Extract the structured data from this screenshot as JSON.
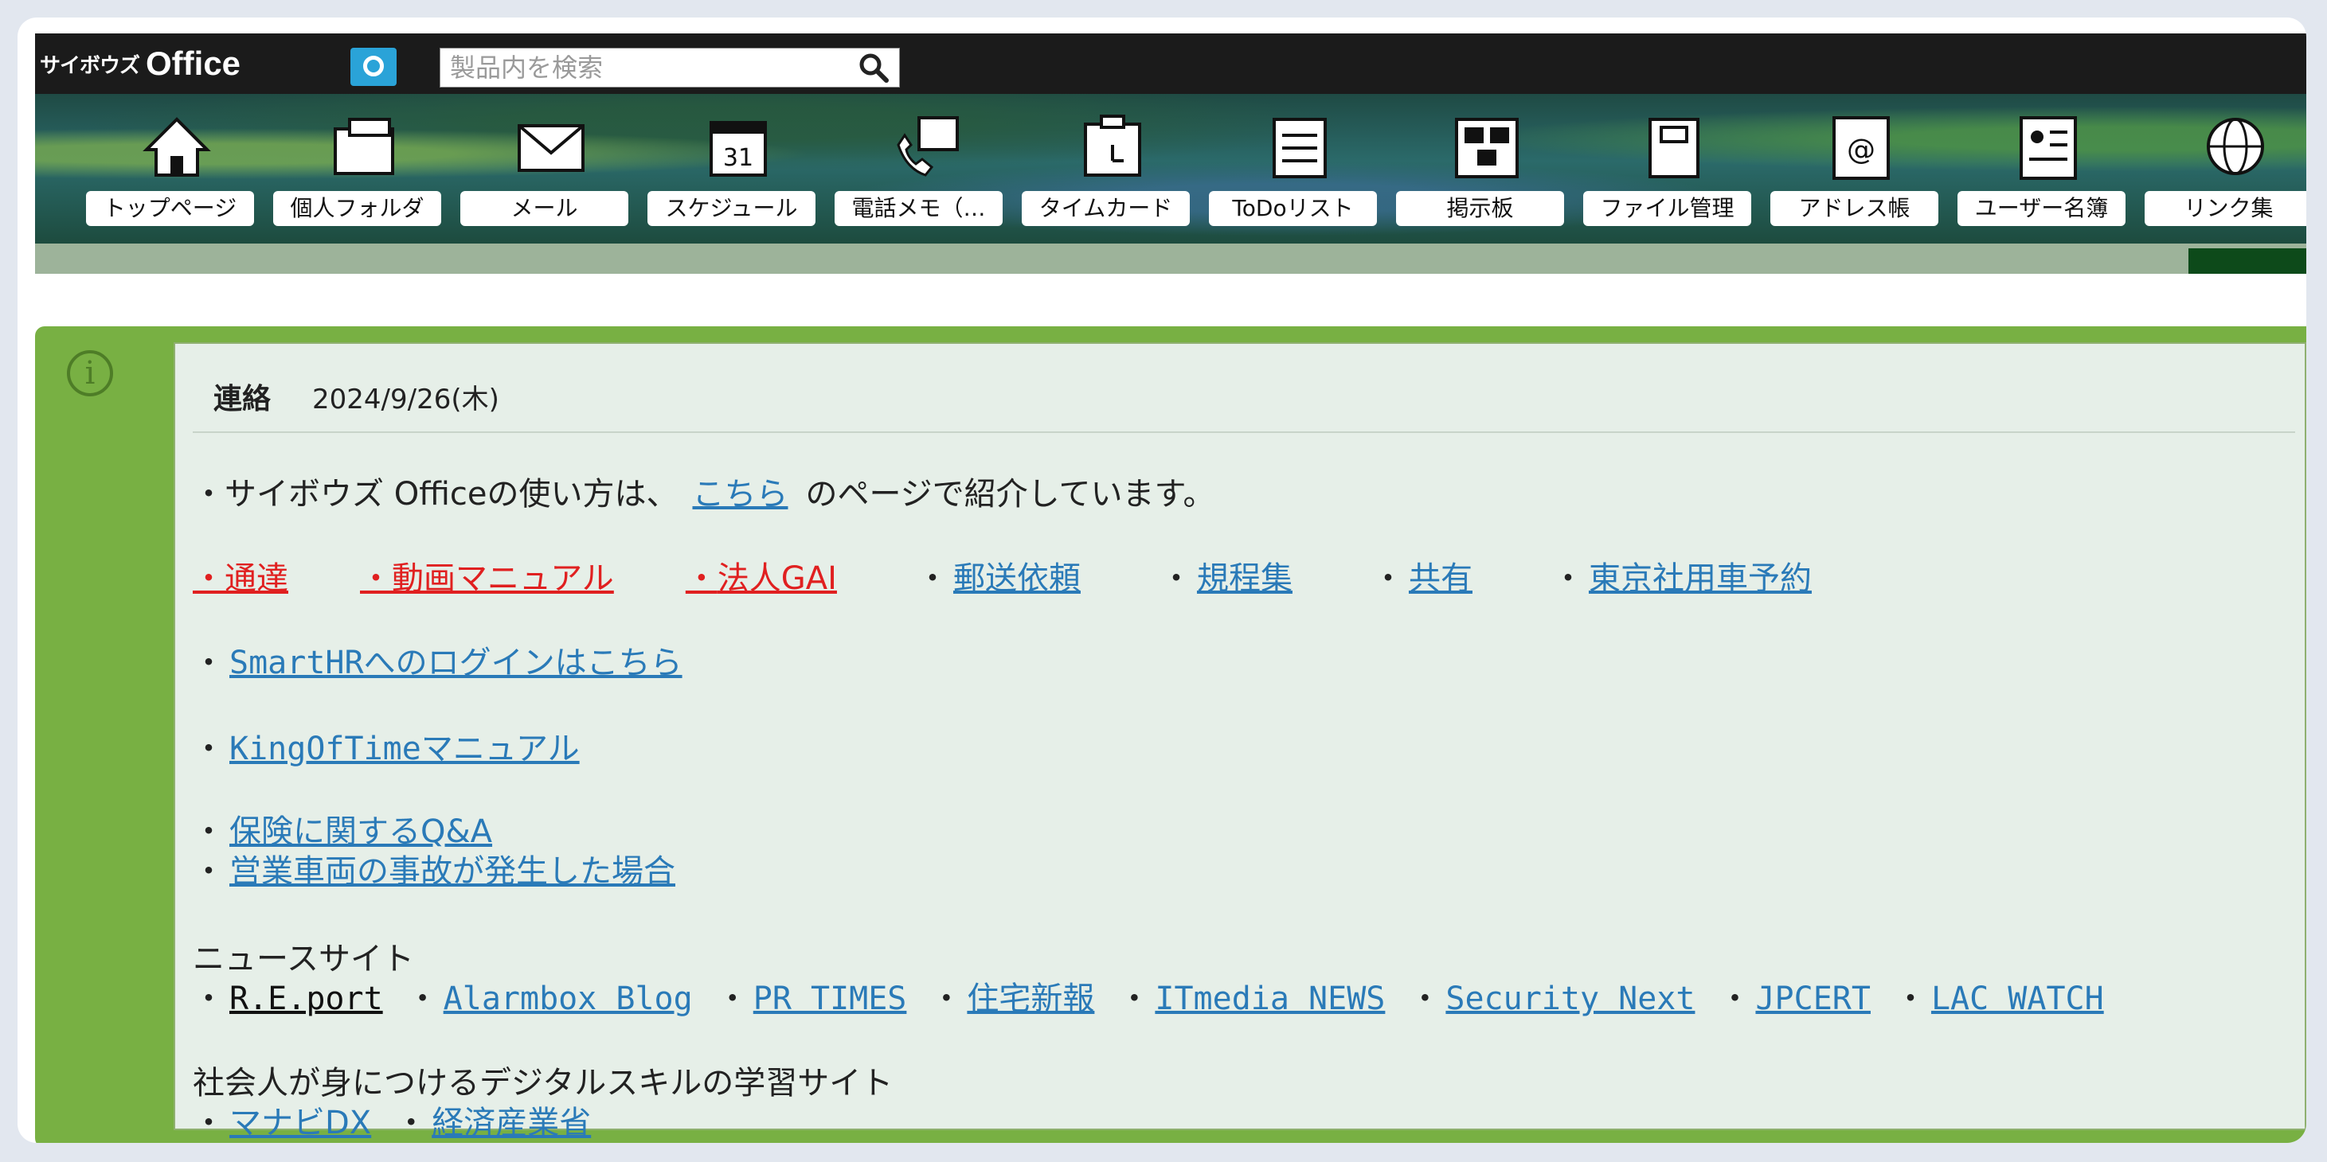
{
  "header": {
    "brand_small": "サイボウズ",
    "brand_big": "Office",
    "search_placeholder": "製品内を検索"
  },
  "nav": [
    {
      "label": "トップページ",
      "icon": "home-icon"
    },
    {
      "label": "個人フォルダ",
      "icon": "folder-icon"
    },
    {
      "label": "メール",
      "icon": "mail-icon"
    },
    {
      "label": "スケジュール",
      "icon": "calendar-icon"
    },
    {
      "label": "電話メモ（…",
      "icon": "phone-memo-icon"
    },
    {
      "label": "タイムカード",
      "icon": "timecard-icon"
    },
    {
      "label": "ToDoリスト",
      "icon": "todo-icon"
    },
    {
      "label": "掲示板",
      "icon": "bulletin-icon"
    },
    {
      "label": "ファイル管理",
      "icon": "file-icon"
    },
    {
      "label": "アドレス帳",
      "icon": "addressbook-icon"
    },
    {
      "label": "ユーザー名簿",
      "icon": "user-directory-icon"
    },
    {
      "label": "リンク集",
      "icon": "globe-icon"
    }
  ],
  "notice": {
    "title": "連絡",
    "date": "2024/9/26(木)",
    "intro": {
      "prefix": "・サイボウズ Officeの使い方は、",
      "link": "こちら",
      "suffix": "のページで紹介しています。"
    },
    "row1": [
      {
        "bullet": "・",
        "text": "通達",
        "style": "red"
      },
      {
        "bullet": "・",
        "text": "動画マニュアル",
        "style": "red"
      },
      {
        "bullet": "・",
        "text": "法人GAI",
        "style": "red"
      },
      {
        "bullet": "・",
        "text": "郵送依頼",
        "style": "link"
      },
      {
        "bullet": "・",
        "text": "規程集",
        "style": "link"
      },
      {
        "bullet": "・",
        "text": "共有",
        "style": "link"
      },
      {
        "bullet": "・",
        "text": "東京社用車予約",
        "style": "link"
      }
    ],
    "smarthr": "SmartHRへのログインはこちら",
    "kingoftime": "KingOfTimeマニュアル",
    "insurance": "保険に関するQ&A",
    "accident": "営業車両の事故が発生した場合",
    "news_heading": "ニュースサイト",
    "news": [
      {
        "text": "R.E.port",
        "style": "blk"
      },
      {
        "text": "Alarmbox Blog",
        "style": "link"
      },
      {
        "text": "PR TIMES",
        "style": "link"
      },
      {
        "text": "住宅新報",
        "style": "link"
      },
      {
        "text": "ITmedia NEWS",
        "style": "link"
      },
      {
        "text": "Security Next",
        "style": "link"
      },
      {
        "text": "JPCERT",
        "style": "link"
      },
      {
        "text": "LAC WATCH",
        "style": "link"
      }
    ],
    "skill_heading": "社会人が身につけるデジタルスキルの学習サイト",
    "skill": [
      {
        "text": "マナビDX"
      },
      {
        "text": "経済産業省"
      }
    ],
    "bullet": "・"
  }
}
